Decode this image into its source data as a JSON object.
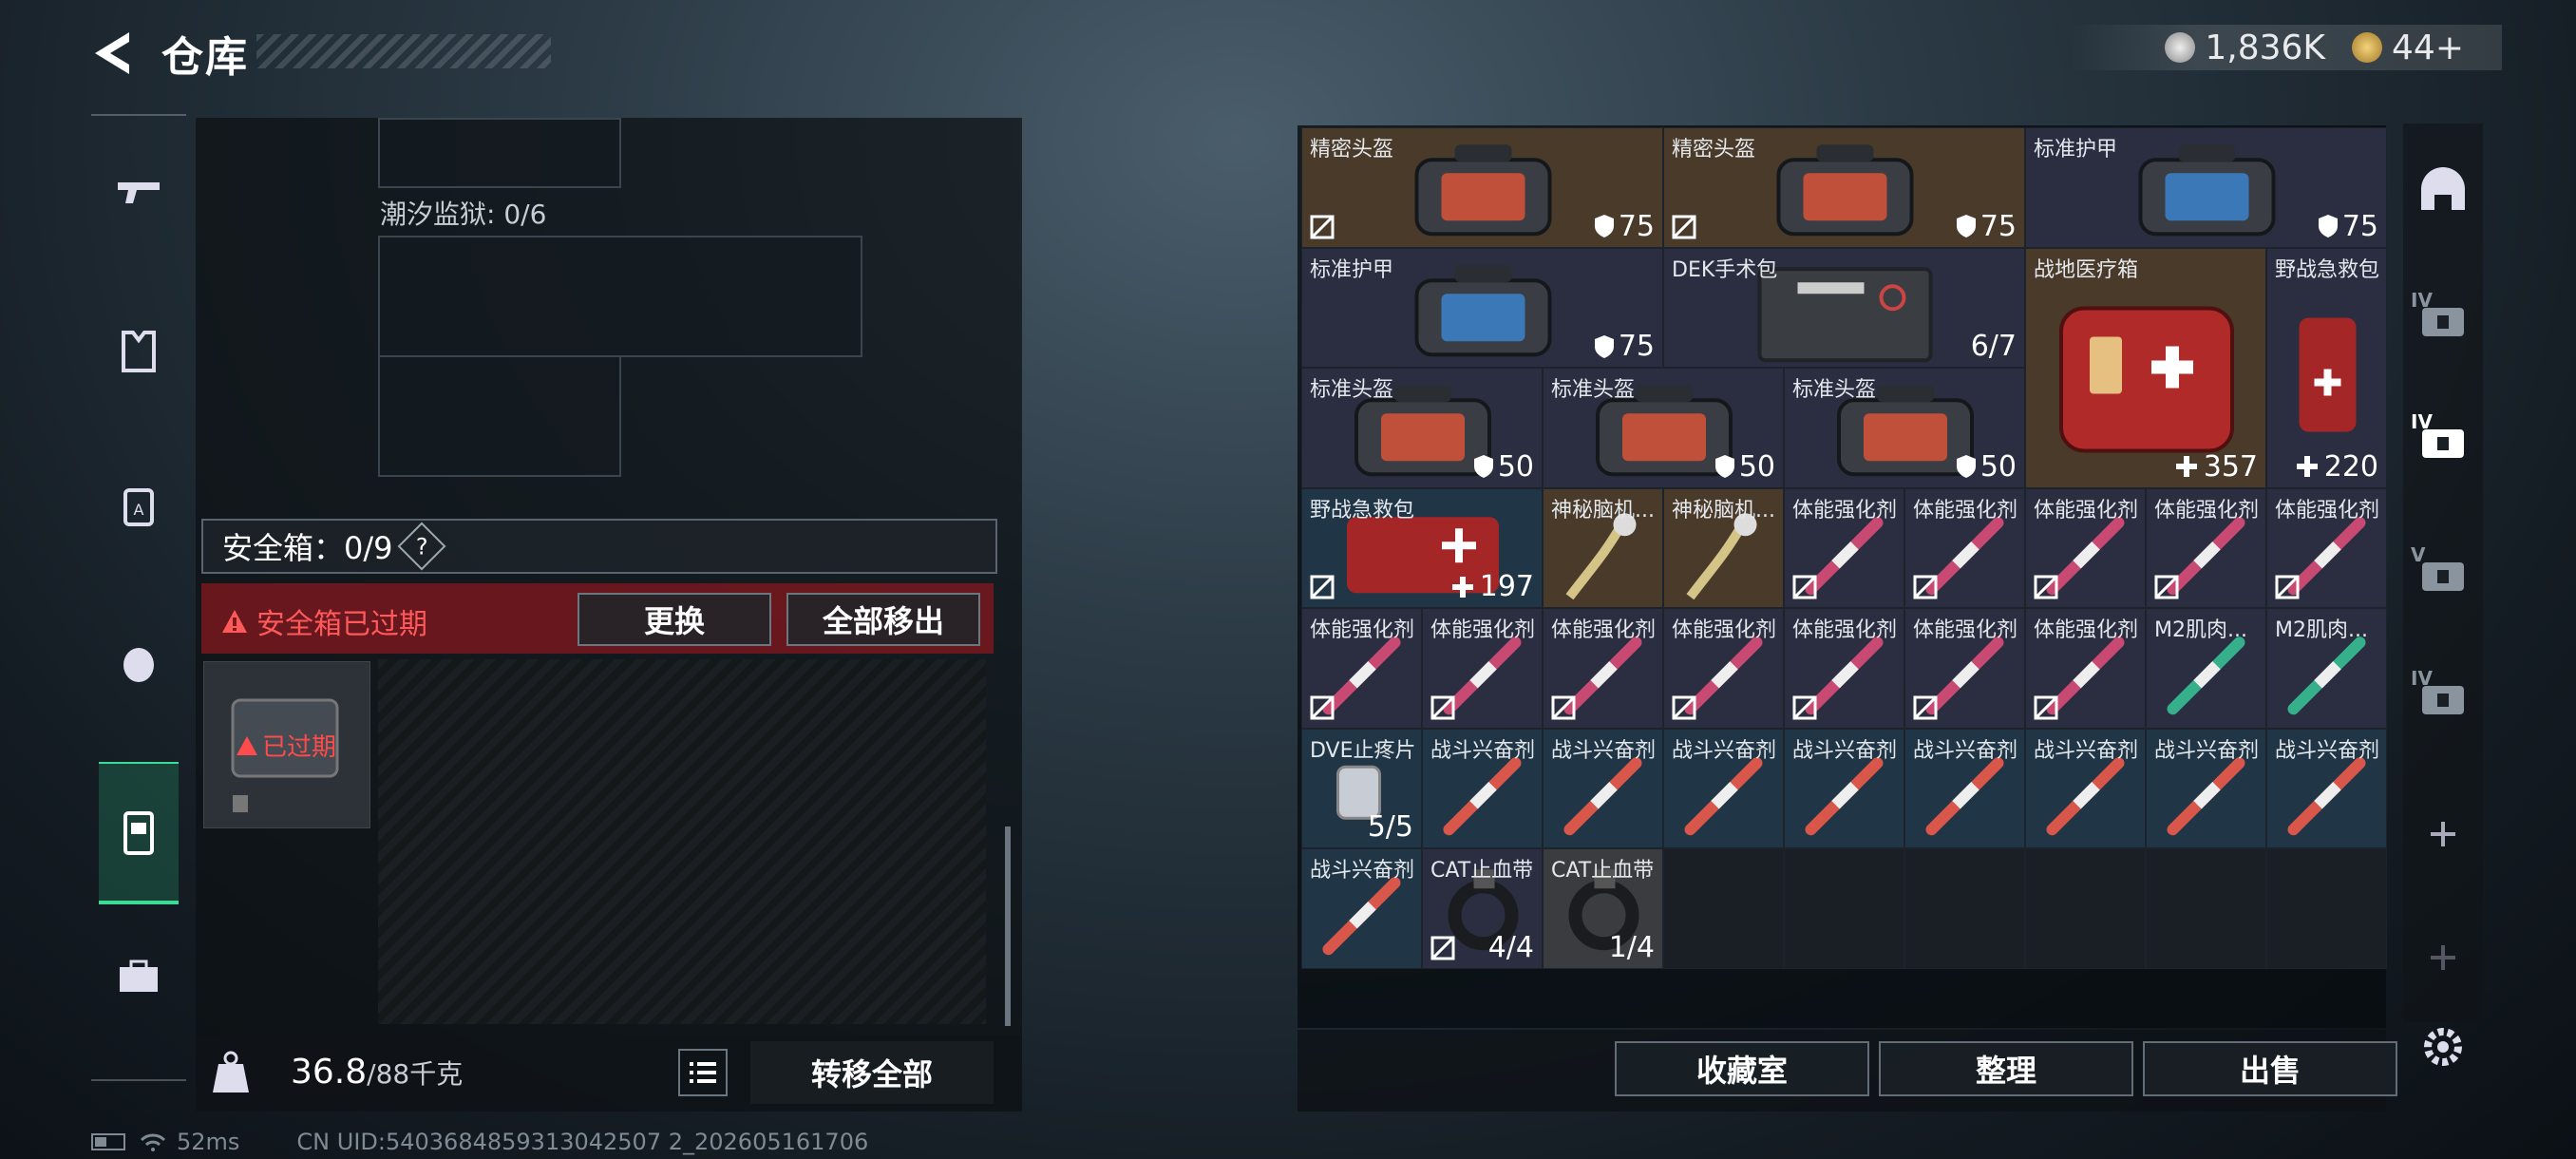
{
  "header": {
    "title": "仓库",
    "currency": [
      {
        "icon": "silver-coin-icon",
        "value": "1,836K"
      },
      {
        "icon": "gold-coin-icon",
        "value": "44+"
      }
    ]
  },
  "left_nav": {
    "items": [
      "gun-icon",
      "armor-icon",
      "backpack-icon",
      "helmet-bag-icon",
      "safe-box-icon",
      "toolbox-icon"
    ],
    "active": 4
  },
  "left_panel": {
    "prison_label": "潮汐监狱: 0/6",
    "safe_label": "安全箱：0/9",
    "help": "?",
    "expired_text": "安全箱已过期",
    "replace_button": "更换",
    "remove_all_button": "全部移出",
    "case_expired_text": "已过期",
    "weight_value": "36.8",
    "weight_max": "/88千克",
    "transfer_all_button": "转移全部"
  },
  "status": {
    "ping": "52ms",
    "uid": "CN UID:5403684859313042507 2_202605161706"
  },
  "items": [
    {
      "name": "精密头盔",
      "value": "75",
      "kind": "bag-orange",
      "bg": "#4a3a2a",
      "nosell": true,
      "shield": true
    },
    {
      "name": "精密头盔",
      "value": "75",
      "kind": "bag-orange",
      "bg": "#4a3a2a",
      "nosell": true,
      "shield": true
    },
    {
      "name": "标准护甲",
      "value": "75",
      "kind": "bag-blue",
      "bg": "#2a2e40",
      "shield": true
    },
    {
      "name": "标准护甲",
      "value": "75",
      "kind": "bag-blue",
      "bg": "#2a2e40",
      "shield": true
    },
    {
      "name": "DEK手术包",
      "value": "6/7",
      "kind": "surgery",
      "bg": "#2a2e40"
    },
    {
      "name": "战地医疗箱",
      "value": "357",
      "kind": "medbox",
      "bg": "#4a3a2a",
      "plus": true
    },
    {
      "name": "野战急救包",
      "value": "220",
      "kind": "aid",
      "bg": "#2a2e40",
      "plus": true
    },
    {
      "name": "标准头盔",
      "value": "50",
      "kind": "bag-orange",
      "bg": "#2a2e40",
      "shield": true
    },
    {
      "name": "标准头盔",
      "value": "50",
      "kind": "bag-orange",
      "bg": "#2a2e40",
      "shield": true
    },
    {
      "name": "标准头盔",
      "value": "50",
      "kind": "bag-orange",
      "bg": "#2a2e40",
      "shield": true
    },
    {
      "name": "野战急救包",
      "value": "197",
      "kind": "aid-h",
      "bg": "#203646",
      "nosell": true,
      "plus": true
    },
    {
      "name": "神秘脑机...",
      "value": "",
      "kind": "brain",
      "bg": "#4a3a2a"
    },
    {
      "name": "神秘脑机...",
      "value": "",
      "kind": "brain",
      "bg": "#4a3a2a"
    },
    {
      "name": "体能强化剂",
      "kind": "syr-pink",
      "bg": "#2a2e40",
      "nosell": true
    },
    {
      "name": "体能强化剂",
      "kind": "syr-pink",
      "bg": "#2a2e40",
      "nosell": true
    },
    {
      "name": "体能强化剂",
      "kind": "syr-pink",
      "bg": "#2a2e40",
      "nosell": true
    },
    {
      "name": "体能强化剂",
      "kind": "syr-pink",
      "bg": "#2a2e40",
      "nosell": true
    },
    {
      "name": "体能强化剂",
      "kind": "syr-pink",
      "bg": "#2a2e40",
      "nosell": true
    },
    {
      "name": "体能强化剂",
      "kind": "syr-pink",
      "bg": "#2a2e40",
      "nosell": true
    },
    {
      "name": "体能强化剂",
      "kind": "syr-pink",
      "bg": "#2a2e40",
      "nosell": true
    },
    {
      "name": "体能强化剂",
      "kind": "syr-pink",
      "bg": "#2a2e40",
      "nosell": true
    },
    {
      "name": "体能强化剂",
      "kind": "syr-pink",
      "bg": "#2a2e40",
      "nosell": true
    },
    {
      "name": "体能强化剂",
      "kind": "syr-pink",
      "bg": "#2a2e40",
      "nosell": true
    },
    {
      "name": "体能强化剂",
      "kind": "syr-pink",
      "bg": "#2a2e40",
      "nosell": true
    },
    {
      "name": "体能强化剂",
      "kind": "syr-pink",
      "bg": "#2a2e40",
      "nosell": true
    },
    {
      "name": "M2肌肉...",
      "kind": "syr-green",
      "bg": "#2a2e40"
    },
    {
      "name": "M2肌肉...",
      "kind": "syr-green",
      "bg": "#2a2e40"
    },
    {
      "name": "DVE止疼片",
      "value": "5/5",
      "kind": "pill",
      "bg": "#203646"
    },
    {
      "name": "战斗兴奋剂",
      "kind": "syr-red",
      "bg": "#203646"
    },
    {
      "name": "战斗兴奋剂",
      "kind": "syr-red",
      "bg": "#203646"
    },
    {
      "name": "战斗兴奋剂",
      "kind": "syr-red",
      "bg": "#203646"
    },
    {
      "name": "战斗兴奋剂",
      "kind": "syr-red",
      "bg": "#203646"
    },
    {
      "name": "战斗兴奋剂",
      "kind": "syr-red",
      "bg": "#203646"
    },
    {
      "name": "战斗兴奋剂",
      "kind": "syr-red",
      "bg": "#203646"
    },
    {
      "name": "战斗兴奋剂",
      "kind": "syr-red",
      "bg": "#203646"
    },
    {
      "name": "战斗兴奋剂",
      "kind": "syr-red",
      "bg": "#203646"
    },
    {
      "name": "战斗兴奋剂",
      "kind": "syr-red",
      "bg": "#203646"
    },
    {
      "name": "CAT止血带",
      "value": "4/4",
      "kind": "tourniquet",
      "bg": "#2a2e40",
      "nosell": true
    },
    {
      "name": "CAT止血带",
      "value": "1/4",
      "kind": "tourniquet",
      "bg": "#3a3c40"
    }
  ],
  "bottom_buttons": [
    "收藏室",
    "整理",
    "出售"
  ],
  "right_nav": {
    "items": [
      "helmet-tab-icon",
      "folder-iv-icon",
      "medkit-iv-plus-icon",
      "medkit-v-icon",
      "medkit-iv-icon",
      "add-icon",
      "add-icon-dim",
      "settings-icon"
    ],
    "labels": [
      "",
      "IV",
      "IV",
      "V",
      "IV",
      "+",
      "+",
      ""
    ]
  }
}
